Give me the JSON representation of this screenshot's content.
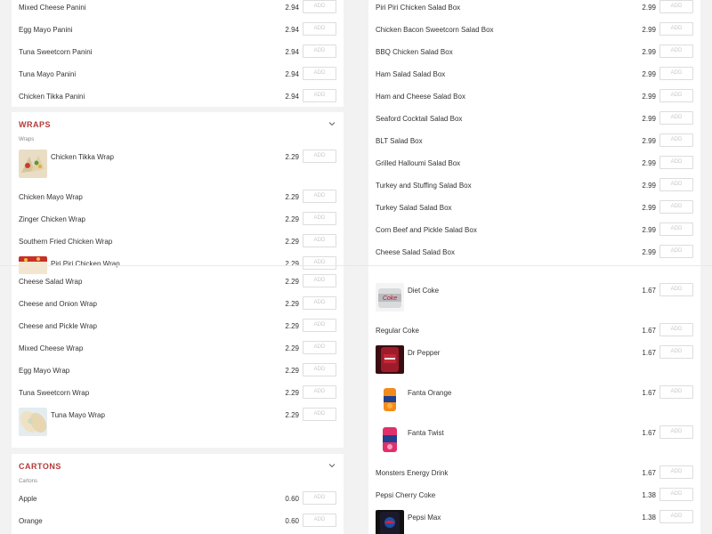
{
  "left": {
    "panini_rows": [
      {
        "name": "Mixed Cheese Panini",
        "price": "2.94",
        "add": "ADD"
      },
      {
        "name": "Egg Mayo Panini",
        "price": "2.94",
        "add": "ADD"
      },
      {
        "name": "Tuna Sweetcorn Panini",
        "price": "2.94",
        "add": "ADD"
      },
      {
        "name": "Tuna Mayo Panini",
        "price": "2.94",
        "add": "ADD"
      },
      {
        "name": "Chicken Tikka Panini",
        "price": "2.94",
        "add": "ADD"
      }
    ],
    "wraps": {
      "title": "WRAPS",
      "subtitle": "Wraps",
      "rows": [
        {
          "name": "Chicken Tikka Wrap",
          "price": "2.29",
          "add": "ADD"
        },
        {
          "name": "Chicken Mayo Wrap",
          "price": "2.29",
          "add": "ADD"
        },
        {
          "name": "Zinger Chicken Wrap",
          "price": "2.29",
          "add": "ADD"
        },
        {
          "name": "Southern Fried Chicken Wrap",
          "price": "2.29",
          "add": "ADD"
        },
        {
          "name": "Piri Piri Chicken Wrap",
          "price": "2.29",
          "add": "ADD"
        },
        {
          "name": "Cheese Salad Wrap",
          "price": "2.29",
          "add": "ADD"
        },
        {
          "name": "Cheese and Onion Wrap",
          "price": "2.29",
          "add": "ADD"
        },
        {
          "name": "Cheese and Pickle Wrap",
          "price": "2.29",
          "add": "ADD"
        },
        {
          "name": "Mixed Cheese Wrap",
          "price": "2.29",
          "add": "ADD"
        },
        {
          "name": "Egg Mayo Wrap",
          "price": "2.29",
          "add": "ADD"
        },
        {
          "name": "Tuna Sweetcorn Wrap",
          "price": "2.29",
          "add": "ADD"
        },
        {
          "name": "Tuna Mayo Wrap",
          "price": "2.29",
          "add": "ADD"
        }
      ]
    },
    "cartons": {
      "title": "CARTONS",
      "subtitle": "Cartons",
      "rows": [
        {
          "name": "Apple",
          "price": "0.60",
          "add": "ADD"
        },
        {
          "name": "Orange",
          "price": "0.60",
          "add": "ADD"
        }
      ]
    }
  },
  "right": {
    "salad_rows": [
      {
        "name": "Piri Piri Chicken Salad Box",
        "price": "2.99",
        "add": "ADD"
      },
      {
        "name": "Chicken Bacon Sweetcorn Salad Box",
        "price": "2.99",
        "add": "ADD"
      },
      {
        "name": "BBQ Chicken Salad Box",
        "price": "2.99",
        "add": "ADD"
      },
      {
        "name": "Ham Salad Salad Box",
        "price": "2.99",
        "add": "ADD"
      },
      {
        "name": "Ham and Cheese Salad Box",
        "price": "2.99",
        "add": "ADD"
      },
      {
        "name": "Seaford Cocktail Salad Box",
        "price": "2.99",
        "add": "ADD"
      },
      {
        "name": "BLT Salad Box",
        "price": "2.99",
        "add": "ADD"
      },
      {
        "name": "Grilled Halloumi Salad Box",
        "price": "2.99",
        "add": "ADD"
      },
      {
        "name": "Turkey and Stuffing Salad Box",
        "price": "2.99",
        "add": "ADD"
      },
      {
        "name": "Turkey Salad Salad Box",
        "price": "2.99",
        "add": "ADD"
      },
      {
        "name": "Corn Beef and Pickle Salad Box",
        "price": "2.99",
        "add": "ADD"
      },
      {
        "name": "Cheese Salad Salad Box",
        "price": "2.99",
        "add": "ADD"
      }
    ],
    "drinks_rows": [
      {
        "name": "Diet Coke",
        "price": "1.67",
        "add": "ADD"
      },
      {
        "name": "Regular Coke",
        "price": "1.67",
        "add": "ADD"
      },
      {
        "name": "Dr Pepper",
        "price": "1.67",
        "add": "ADD"
      },
      {
        "name": "Fanta Orange",
        "price": "1.67",
        "add": "ADD"
      },
      {
        "name": "Fanta Twist",
        "price": "1.67",
        "add": "ADD"
      },
      {
        "name": "Monsters Energy Drink",
        "price": "1.67",
        "add": "ADD"
      },
      {
        "name": "Pepsi Cherry Coke",
        "price": "1.38",
        "add": "ADD"
      },
      {
        "name": "Pepsi Max",
        "price": "1.38",
        "add": "ADD"
      }
    ]
  },
  "colors": {
    "accent": "#b43a3a",
    "background": "#f2f2f2",
    "card": "#ffffff"
  },
  "icons": {
    "collapse": "chevron-down-icon"
  }
}
